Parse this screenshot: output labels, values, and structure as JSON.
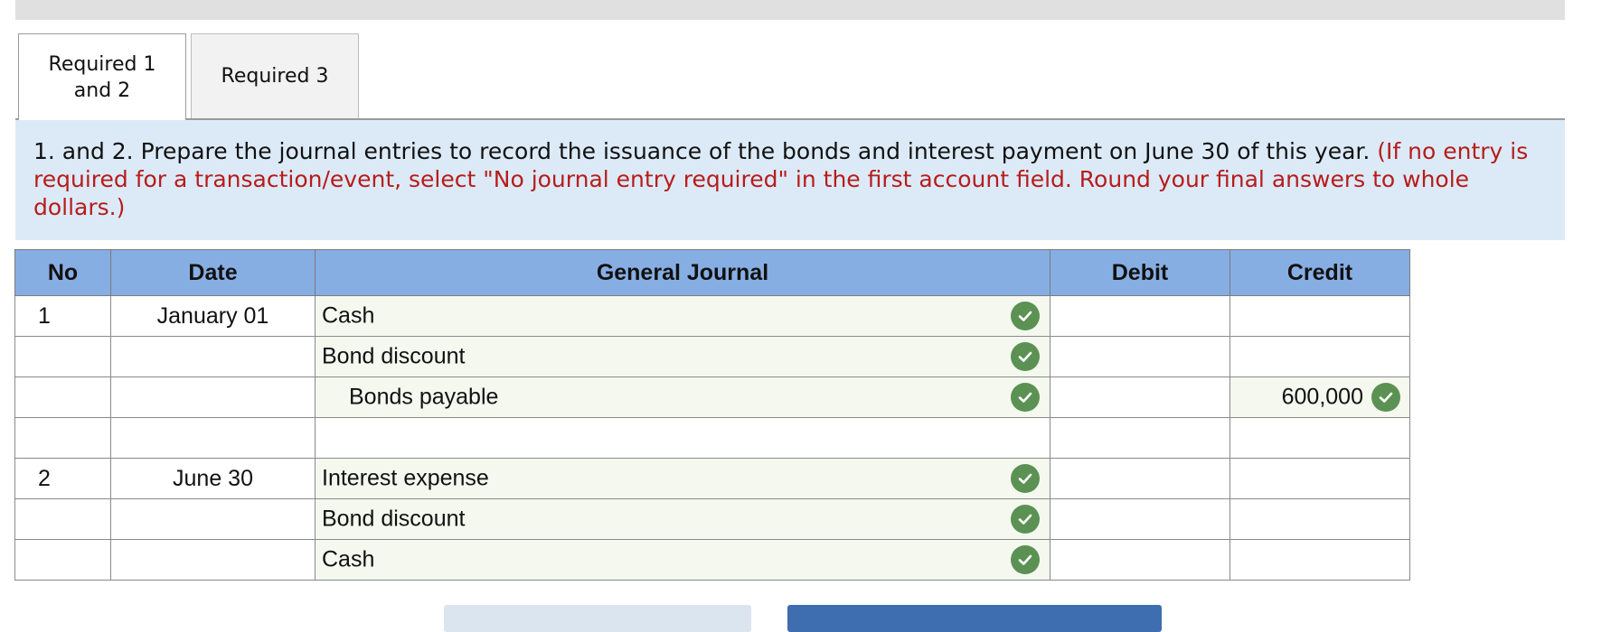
{
  "tabs": [
    {
      "label_line1": "Required 1",
      "label_line2": "and 2",
      "active": true
    },
    {
      "label_line1": "Required 3",
      "active": false
    }
  ],
  "instructions": {
    "main": "1. and 2. Prepare the journal entries to record the issuance of the bonds and interest payment on June 30 of this year.",
    "note": "(If no entry is required for a transaction/event, select \"No journal entry required\" in the first account field. Round your final answers to whole dollars.)"
  },
  "table": {
    "headers": {
      "no": "No",
      "date": "Date",
      "general_journal": "General Journal",
      "debit": "Debit",
      "credit": "Credit"
    },
    "rows": [
      {
        "no": "1",
        "date": "January 01",
        "account": "Cash",
        "debit": "",
        "credit": "",
        "correct": true
      },
      {
        "no": "",
        "date": "",
        "account": "Bond discount",
        "debit": "",
        "credit": "",
        "correct": true
      },
      {
        "no": "",
        "date": "",
        "account": "Bonds payable",
        "debit": "",
        "credit": "600,000",
        "correct": true
      },
      {
        "no": "",
        "date": "",
        "account": "",
        "debit": "",
        "credit": "",
        "correct": false
      },
      {
        "no": "2",
        "date": "June 30",
        "account": "Interest expense",
        "debit": "",
        "credit": "",
        "correct": true
      },
      {
        "no": "",
        "date": "",
        "account": "Bond discount",
        "debit": "",
        "credit": "",
        "correct": true
      },
      {
        "no": "",
        "date": "",
        "account": "Cash",
        "debit": "",
        "credit": "",
        "correct": true
      }
    ]
  },
  "colors": {
    "header_bg": "#87aee3",
    "instructions_bg": "#dceaf7",
    "note_red": "#b71c1c",
    "check_green": "#5c9154",
    "filled_cell_bg": "#f4f8ef"
  }
}
